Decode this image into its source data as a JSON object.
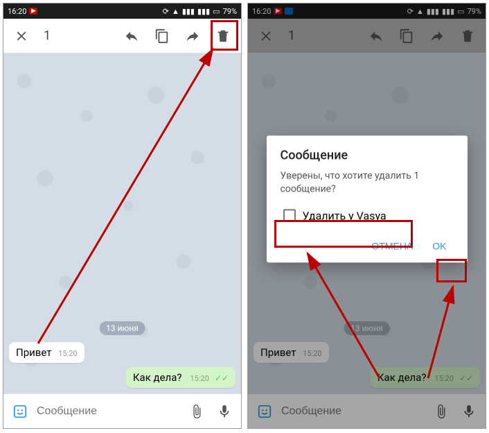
{
  "status": {
    "time": "16:20",
    "battery": "79%"
  },
  "appbar": {
    "selected_count": "1"
  },
  "chat": {
    "date": "13 июня",
    "msg_in": "Привет",
    "msg_in_time": "15:20",
    "msg_out": "Как дела?",
    "msg_out_time": "15:20"
  },
  "input": {
    "placeholder": "Сообщение"
  },
  "dialog": {
    "title": "Сообщение",
    "body": "Уверены, что хотите удалить 1 сообщение?",
    "checkbox_label": "Удалить у Vasya",
    "cancel": "ОТМЕНА",
    "ok": "OK"
  }
}
